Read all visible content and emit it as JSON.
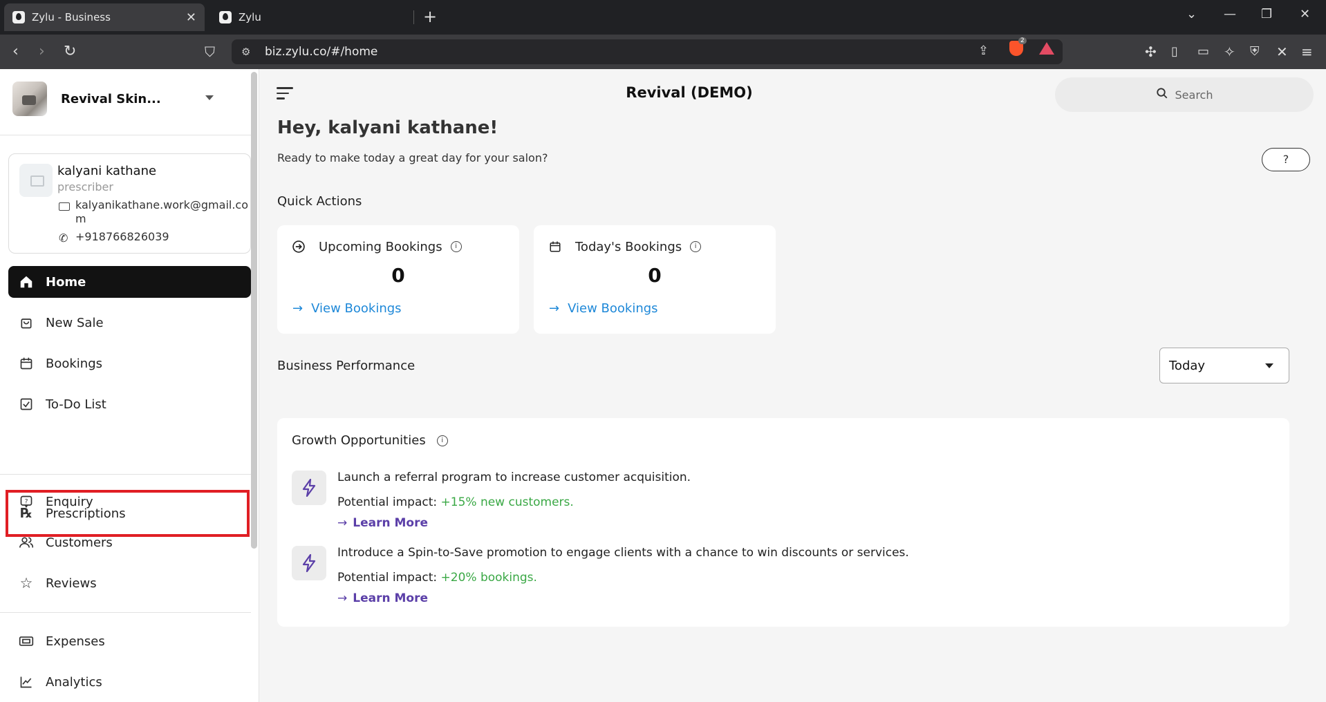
{
  "browser": {
    "tabs": [
      {
        "title": "Zylu - Business",
        "active": true
      },
      {
        "title": "Zylu",
        "active": false
      }
    ],
    "url": "biz.zylu.co/#/home",
    "shields_count": "2"
  },
  "sidebar": {
    "business_name": "Revival Skin...",
    "profile": {
      "name": "kalyani kathane",
      "role": "prescriber",
      "email": "kalyanikathane.work@gmail.com",
      "phone": "+918766826039"
    },
    "nav": [
      {
        "label": "Home",
        "icon": "home-icon",
        "active": true
      },
      {
        "label": "New Sale",
        "icon": "shopping-bag-icon"
      },
      {
        "label": "Bookings",
        "icon": "calendar-icon"
      },
      {
        "label": "To-Do List",
        "icon": "checkbox-icon"
      },
      {
        "label": "Prescriptions",
        "icon": "rx-icon",
        "highlighted": true
      },
      {
        "label": "Enquiry",
        "icon": "question-chat-icon"
      },
      {
        "label": "Customers",
        "icon": "users-icon"
      },
      {
        "label": "Reviews",
        "icon": "star-icon"
      },
      {
        "label": "Expenses",
        "icon": "wallet-icon"
      },
      {
        "label": "Analytics",
        "icon": "chart-line-icon"
      }
    ]
  },
  "header": {
    "title": "Revival (DEMO)",
    "search_placeholder": "Search"
  },
  "greeting": {
    "title": "Hey,  kalyani kathane!",
    "subtitle": "Ready to make today a great day for your salon?",
    "help_label": "?"
  },
  "quick_actions": {
    "label": "Quick Actions",
    "cards": [
      {
        "title": "Upcoming Bookings",
        "value": "0",
        "link": "View Bookings",
        "icon": "arrow-circle-icon"
      },
      {
        "title": "Today's Bookings",
        "value": "0",
        "link": "View Bookings",
        "icon": "calendar-icon"
      }
    ]
  },
  "performance": {
    "label": "Business Performance",
    "period": "Today"
  },
  "growth": {
    "title": "Growth Opportunities",
    "items": [
      {
        "text": "Launch a referral program to increase customer acquisition.",
        "impact_label": "Potential impact: ",
        "impact_value": "+15% new customers.",
        "more": "Learn More"
      },
      {
        "text": "Introduce a Spin-to-Save promotion to engage clients with a chance to win discounts or services.",
        "impact_label": "Potential impact: ",
        "impact_value": "+20% bookings.",
        "more": "Learn More"
      }
    ]
  },
  "colors": {
    "accent_blue": "#1e88d8",
    "accent_purple": "#5b3fa8",
    "impact_green": "#3aa845",
    "nav_active_bg": "#121212",
    "highlight_red": "#e01e24"
  }
}
